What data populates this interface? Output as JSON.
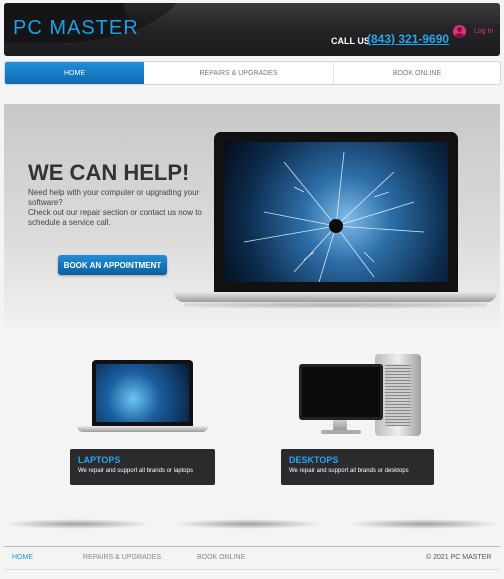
{
  "header": {
    "logo": "PC MASTER",
    "call_label": "CALL US",
    "phone": "(843) 321-9690",
    "login_label": "Log In"
  },
  "nav": {
    "tabs": [
      "HOME",
      "REPAIRS & UPGRADES",
      "BOOK ONLINE"
    ],
    "active": "HOME"
  },
  "hero": {
    "heading": "WE CAN HELP!",
    "line1": "Need help with your computer or upgrading your software?",
    "line2": "Check out our repair section or contact us now to schedule a service call.",
    "button": "BOOK AN APPOINTMENT"
  },
  "products": [
    {
      "title": "LAPTOPS",
      "desc": "We repair and support all brands or laptops"
    },
    {
      "title": "DESKTOPS",
      "desc": "We repair and support all brands or desktops"
    }
  ],
  "footer": {
    "links": [
      "HOME",
      "REPAIRS & UPGRADES",
      "BOOK ONLINE"
    ],
    "copyright": "© 2021 PC MASTER"
  },
  "colors": {
    "accent": "#1f8fd8",
    "header_bg": "#2b2b2d",
    "login": "#e0307a"
  }
}
